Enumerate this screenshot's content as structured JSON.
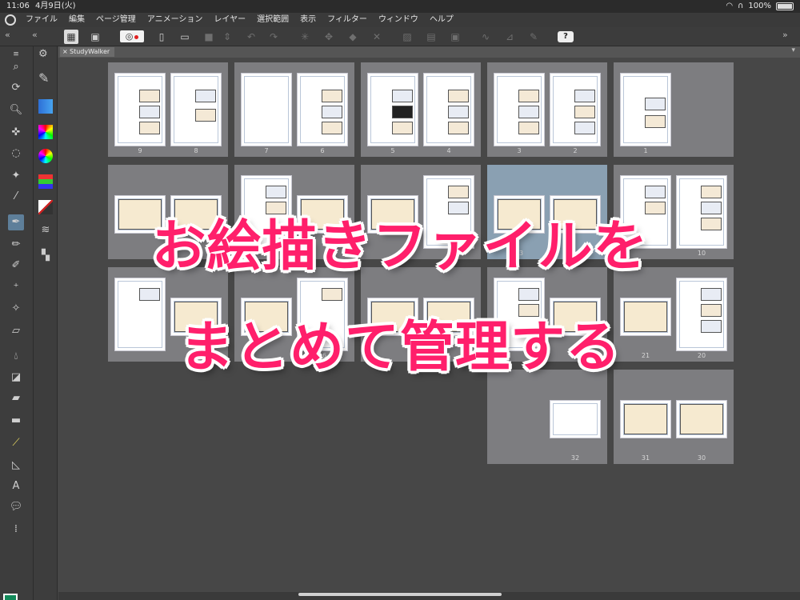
{
  "status": {
    "time": "11:06",
    "date": "4月9日(火)",
    "battery": "100%"
  },
  "menu": [
    "ファイル",
    "編集",
    "ページ管理",
    "アニメーション",
    "レイヤー",
    "選択範囲",
    "表示",
    "フィルター",
    "ウィンドウ",
    "ヘルプ"
  ],
  "document": {
    "tab_title": "StudyWalker"
  },
  "headline": {
    "line1": "お絵描きファイルを",
    "line2": "まとめて管理する"
  },
  "pages": {
    "row1": [
      "9",
      "8",
      "7",
      "6",
      "5",
      "4",
      "3",
      "2",
      "1"
    ],
    "row2": [
      "13",
      "10"
    ],
    "row3": [
      "26",
      "21",
      "20"
    ],
    "row4": [
      "32",
      "31",
      "30"
    ]
  },
  "colors": {
    "main_color": "#138a5a",
    "sub_color": "#ffffff",
    "headline": "#ff1f6b"
  }
}
